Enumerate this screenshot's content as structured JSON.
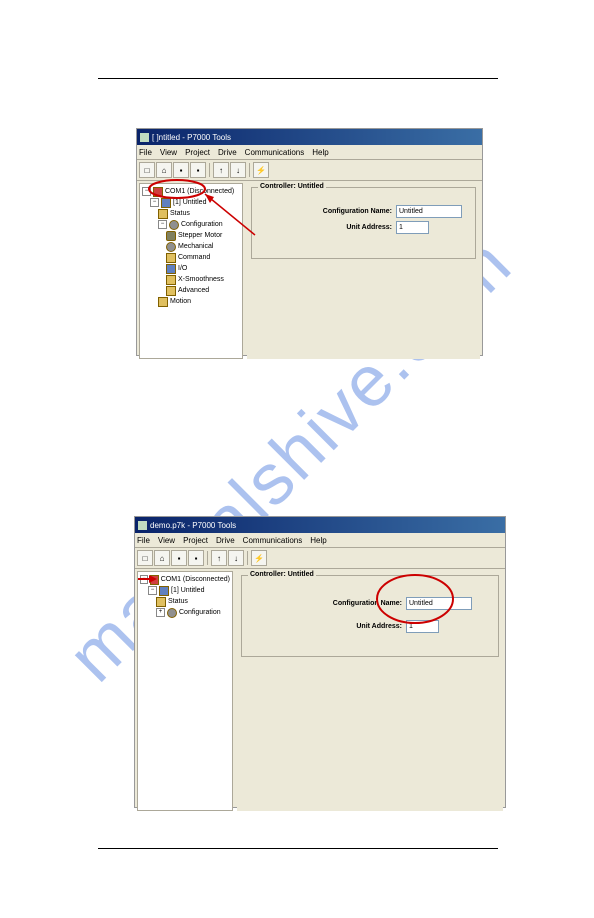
{
  "watermark": "manualshive.com",
  "win1": {
    "title": "[ ]ntitled - P7000 Tools",
    "menu": {
      "file": "File",
      "view": "View",
      "project": "Project",
      "drive": "Drive",
      "communications": "Communications",
      "help": "Help"
    },
    "tree": {
      "root": "COM1 (Disconnected)",
      "node": "[1] Untitled",
      "status": "Status",
      "config": "Configuration",
      "stepper": "Stepper Motor",
      "mechanical": "Mechanical",
      "command": "Command",
      "io": "I/O",
      "xsmooth": "X-Smoothness",
      "advanced": "Advanced",
      "motion": "Motion"
    },
    "panel": {
      "header": "Controller: Untitled",
      "cfg_label": "Configuration Name:",
      "cfg_value": "Untitled",
      "addr_label": "Unit Address:",
      "addr_value": "1"
    }
  },
  "win2": {
    "title": "demo.p7k - P7000 Tools",
    "menu": {
      "file": "File",
      "view": "View",
      "project": "Project",
      "drive": "Drive",
      "communications": "Communications",
      "help": "Help"
    },
    "tree": {
      "root": "COM1 (Disconnected)",
      "node": "[1] Untitled",
      "status": "Status",
      "config": "Configuration"
    },
    "panel": {
      "header": "Controller: Untitled",
      "cfg_label": "Configuration Name:",
      "cfg_value": "Untitled",
      "addr_label": "Unit Address:",
      "addr_value": "1"
    }
  }
}
